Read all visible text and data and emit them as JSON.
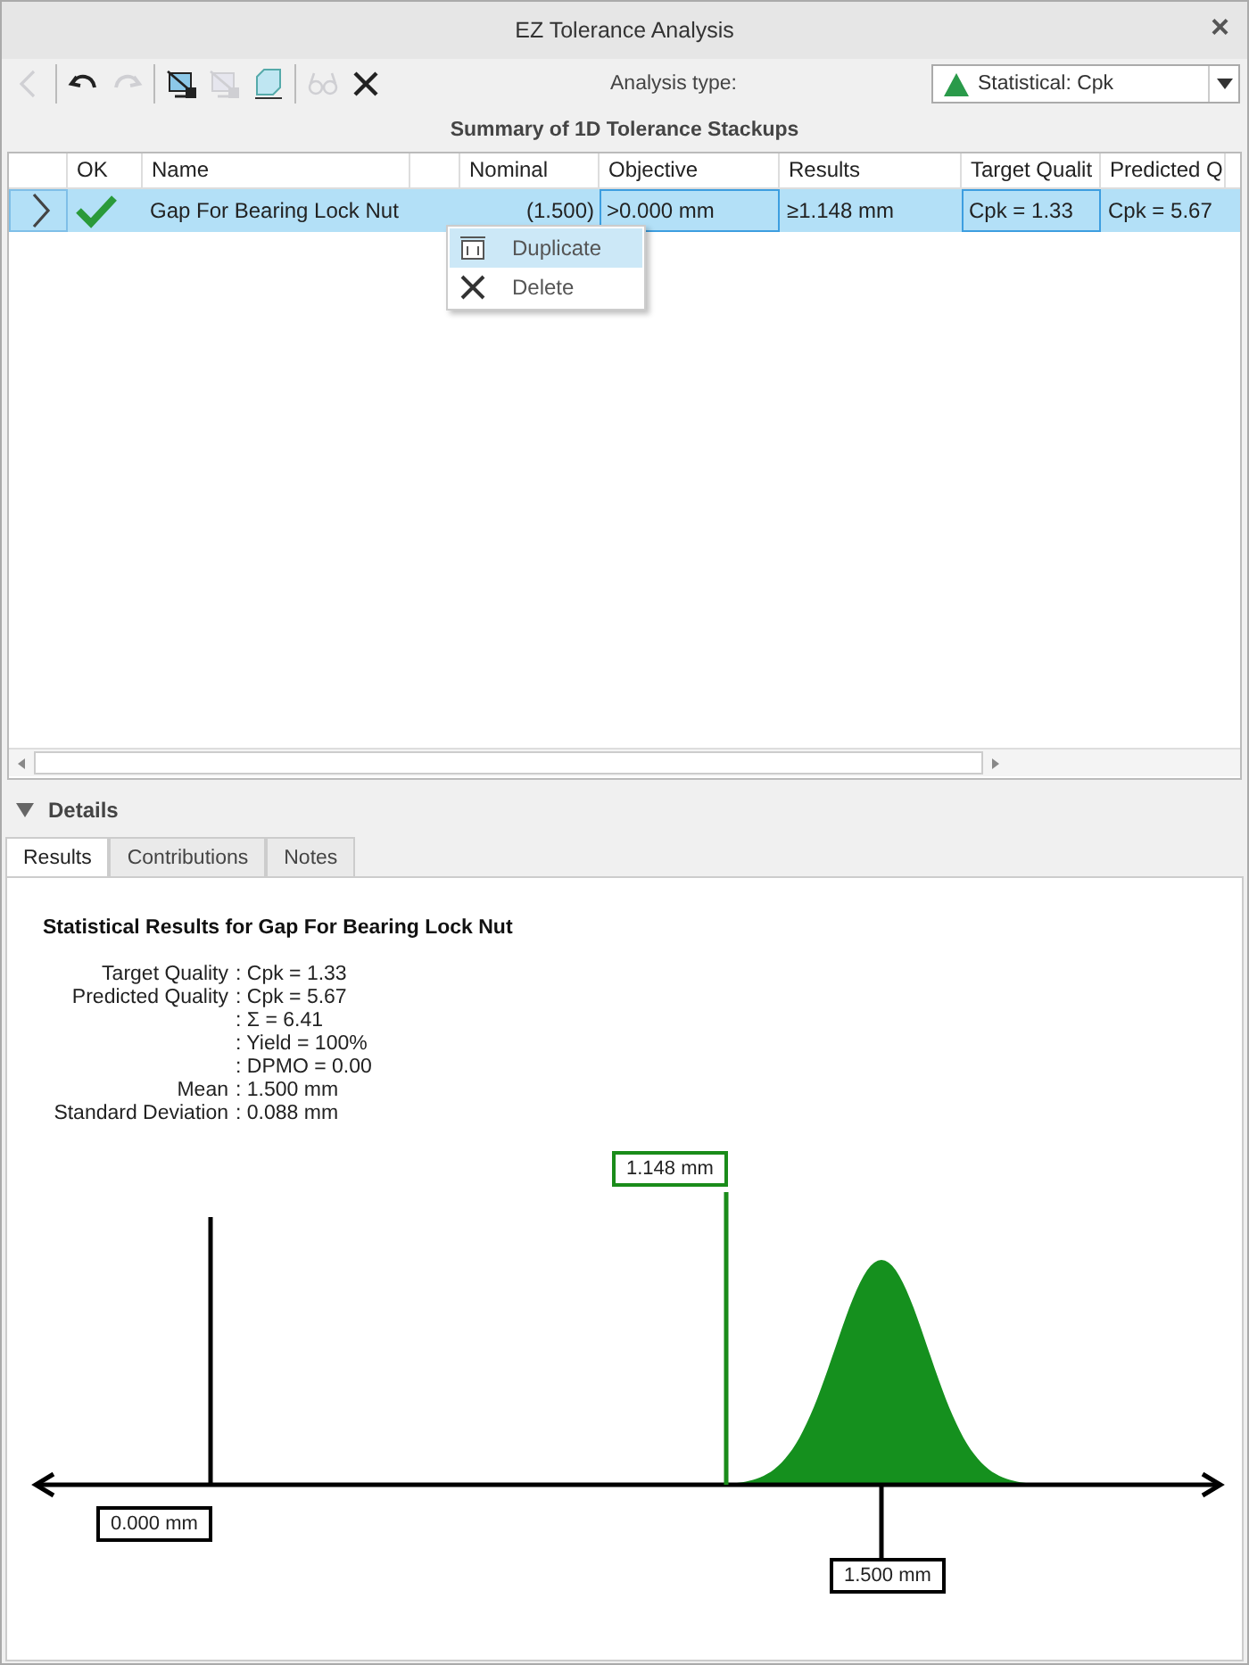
{
  "window": {
    "title": "EZ Tolerance Analysis",
    "close": "×"
  },
  "toolbar": [
    {
      "kind": "back",
      "disabled": true
    },
    {
      "kind": "undo",
      "disabled": false
    },
    {
      "kind": "redo",
      "disabled": true
    },
    {
      "kind": "stack",
      "disabled": false
    },
    {
      "kind": "stack",
      "disabled": true
    },
    {
      "kind": "cube",
      "disabled": false
    },
    {
      "kind": "glasses",
      "disabled": true
    },
    {
      "kind": "delete",
      "disabled": false
    }
  ],
  "analysis_type": {
    "label": "Analysis type:",
    "value": "Statistical: Cpk"
  },
  "table": {
    "title": "Summary of 1D Tolerance Stackups",
    "columns": [
      "",
      "OK",
      "Name",
      "",
      "Nominal",
      "Objective",
      "Results",
      "Target Qualit",
      "Predicted Q"
    ],
    "rows": [
      {
        "selected": true,
        "cells": [
          {
            "kind": "expander"
          },
          {
            "kind": "status",
            "ok": true
          },
          {
            "kind": "text",
            "text": "Gap For Bearing Lock Nut",
            "outlined": false
          },
          {
            "kind": "blank"
          },
          {
            "kind": "text",
            "text": "(1.500)",
            "outlined": false
          },
          {
            "kind": "text",
            "text": ">0.000 mm",
            "outlined": true
          },
          {
            "kind": "text",
            "text": "≥1.148 mm",
            "outlined": false
          },
          {
            "kind": "text",
            "text": "Cpk = 1.33",
            "outlined": true
          },
          {
            "kind": "text",
            "text": "Cpk = 5.67",
            "outlined": false
          }
        ]
      }
    ]
  },
  "context_menu": [
    {
      "kind": "duplicate",
      "label": "Duplicate",
      "selected": true
    },
    {
      "kind": "delete",
      "label": "Delete",
      "selected": false
    }
  ],
  "details": {
    "title": "Details",
    "expanded": true,
    "tabs": [
      {
        "label": "Results",
        "selected": true
      },
      {
        "label": "Contributions",
        "selected": false
      },
      {
        "label": "Notes",
        "selected": false
      }
    ],
    "heading": "Statistical Results for Gap For Bearing Lock Nut",
    "results": [
      {
        "label": "Target Quality",
        "value": ": Cpk = 1.33"
      },
      {
        "label": "Predicted Quality",
        "value": ": Cpk = 5.67"
      },
      {
        "value": ": Σ = 6.41"
      },
      {
        "value": ": Yield = 100%"
      },
      {
        "value": ": DPMO = 0.00"
      },
      {
        "label": "Mean",
        "value": ": 1.500 mm"
      },
      {
        "label": "Standard Deviation",
        "value": ": 0.088 mm"
      }
    ],
    "markers": [
      {
        "kind": "lower_limit",
        "label": "0.000 mm"
      },
      {
        "kind": "result",
        "label": "1.148 mm"
      },
      {
        "kind": "mean",
        "label": "1.500 mm"
      }
    ]
  }
}
